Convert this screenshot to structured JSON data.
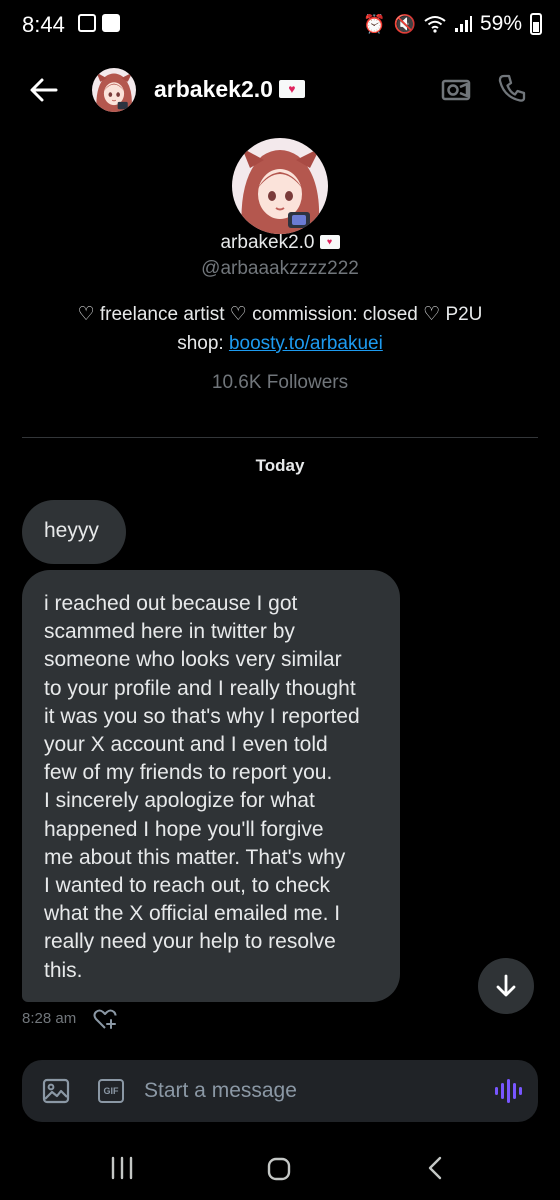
{
  "status_bar": {
    "time": "8:44",
    "battery": "59%"
  },
  "header": {
    "name": "arbakek2.0",
    "icons": [
      "back-arrow-icon",
      "video-camera-icon",
      "phone-icon"
    ]
  },
  "profile": {
    "name": "arbakek2.0",
    "handle": "@arbaaakzzzz222",
    "bio_line1": "♡ freelance artist ♡ commission: closed ♡ P2U",
    "bio_line2_prefix": "shop: ",
    "bio_link": "boosty.to/arbakuei",
    "followers": "10.6K Followers"
  },
  "conversation": {
    "date_separator": "Today",
    "messages": [
      {
        "text": "heyyy"
      },
      {
        "text": "i  reached out because I got\nscammed here in twitter by\nsomeone who looks very similar\nto your profile and I really thought\nit was you so that's why I reported\nyour X account and I even told\nfew of my friends to report you.\nI sincerely apologize for what\nhappened I hope you'll forgive\nme about this matter. That's why\nI wanted to reach out, to check\nwhat the X official emailed me. I\nreally need your help to resolve\nthis."
      }
    ],
    "last_time": "8:28 am"
  },
  "composer": {
    "gif_label": "GIF",
    "placeholder": "Start a message"
  },
  "colors": {
    "background": "#000000",
    "bubble": "#2f3336",
    "link": "#1d9bf0",
    "muted": "#71767b",
    "voice_accent": "#7856ff"
  }
}
